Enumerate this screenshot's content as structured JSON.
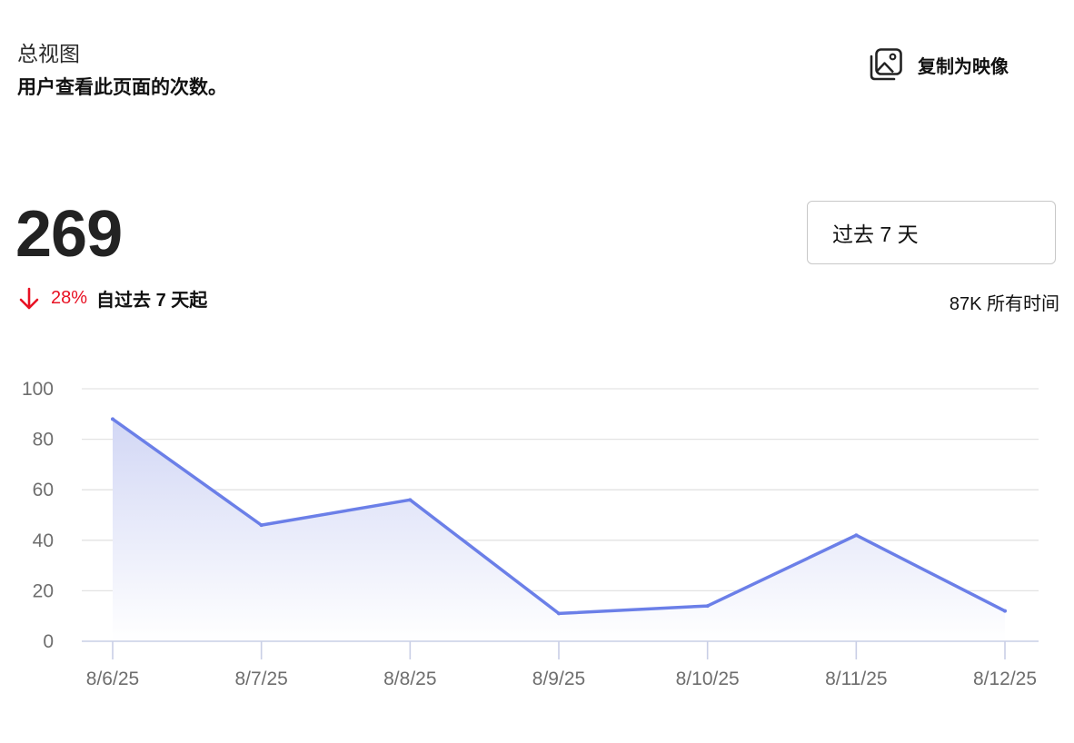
{
  "header": {
    "title": "总视图",
    "subtitle": "用户查看此页面的次数。",
    "copy_button_label": "复制为映像",
    "copy_icon": "image-icon"
  },
  "summary": {
    "total": "269",
    "change_percent": "28%",
    "change_direction": "down",
    "change_icon": "arrow-down-icon",
    "change_since": "自过去 7 天起",
    "all_time": "87K 所有时间"
  },
  "range_select": {
    "selected": "过去 7 天"
  },
  "colors": {
    "line": "#6b7fe8",
    "area_top": "#d2d7f5",
    "area_bottom": "#ffffff",
    "grid": "#e3e3e3",
    "axis": "#c9cfe6",
    "tick_text": "#6e6e6e",
    "negative": "#e81123"
  },
  "chart_data": {
    "type": "area",
    "categories": [
      "8/6/25",
      "8/7/25",
      "8/8/25",
      "8/9/25",
      "8/10/25",
      "8/11/25",
      "8/12/25"
    ],
    "series": [
      {
        "values": [
          88,
          46,
          56,
          11,
          14,
          42,
          12
        ]
      }
    ],
    "y_ticks": [
      0,
      20,
      40,
      60,
      80,
      100
    ],
    "ylim": [
      0,
      100
    ],
    "grid": true,
    "legend": "none"
  }
}
